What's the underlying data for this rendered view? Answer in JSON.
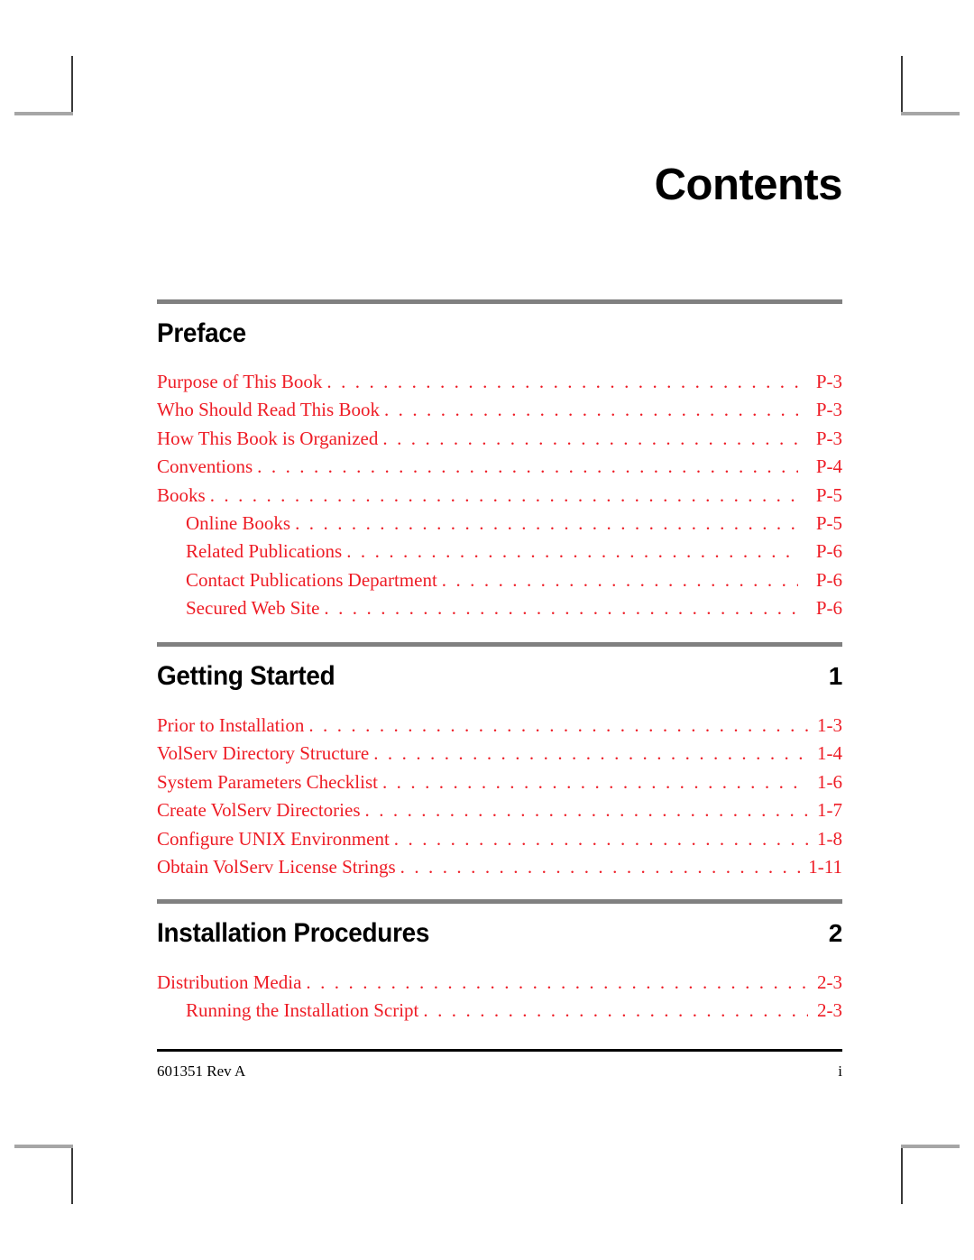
{
  "document": {
    "title": "Contents"
  },
  "sections": [
    {
      "heading": "Preface",
      "number": "",
      "leader_style": "wide",
      "entries": [
        {
          "label": "Purpose of This Book",
          "page": "P-3",
          "level": 1
        },
        {
          "label": "Who Should Read This Book",
          "page": "P-3",
          "level": 1
        },
        {
          "label": "How This Book is Organized",
          "page": "P-3",
          "level": 1
        },
        {
          "label": "Conventions",
          "page": "P-4",
          "level": 1
        },
        {
          "label": "Books",
          "page": "P-5",
          "level": 1
        },
        {
          "label": "Online Books",
          "page": "P-5",
          "level": 2
        },
        {
          "label": "Related Publications",
          "page": "P-6",
          "level": 2
        },
        {
          "label": "Contact Publications Department",
          "page": "P-6",
          "level": 2
        },
        {
          "label": "Secured Web Site",
          "page": "P-6",
          "level": 2
        }
      ]
    },
    {
      "heading": "Getting Started",
      "number": "1",
      "leader_style": "tight",
      "entries": [
        {
          "label": "Prior to Installation",
          "page": "1-3",
          "level": 1
        },
        {
          "label": "VolServ Directory Structure",
          "page": "1-4",
          "level": 1
        },
        {
          "label": "System Parameters Checklist",
          "page": "1-6",
          "level": 1
        },
        {
          "label": "Create VolServ Directories",
          "page": "1-7",
          "level": 1
        },
        {
          "label": "Configure UNIX Environment",
          "page": "1-8",
          "level": 1
        },
        {
          "label": "Obtain VolServ License Strings",
          "page": "1-11",
          "level": 1
        }
      ]
    },
    {
      "heading": "Installation Procedures",
      "number": "2",
      "leader_style": "tight",
      "entries": [
        {
          "label": "Distribution Media",
          "page": "2-3",
          "level": 1
        },
        {
          "label": "Running the Installation Script",
          "page": "2-3",
          "level": 2
        }
      ]
    }
  ],
  "footer": {
    "document_number": "601351 Rev A",
    "page_number": "i"
  },
  "colors": {
    "entry_red": "#ee1c25",
    "section_rule_gray": "#808080",
    "footer_rule_black": "#000000",
    "heading_black": "#000000"
  }
}
